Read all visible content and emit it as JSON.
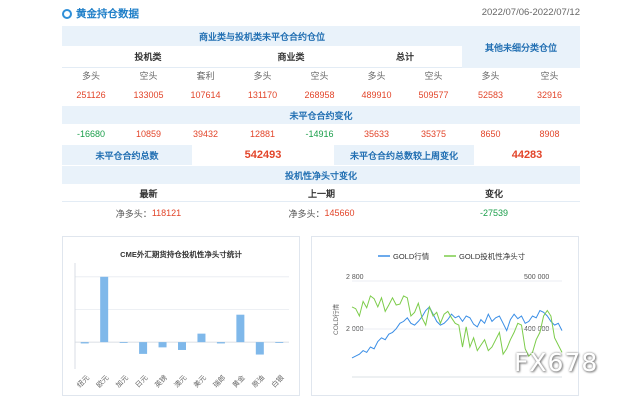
{
  "page": {
    "title": "黄金持仓数据",
    "date_range": "2022/07/06-2022/07/12"
  },
  "table": {
    "section1": {
      "title": "商业类与投机类未平仓合约仓位",
      "other_title": "其他未细分类仓位",
      "groups": {
        "spec": "投机类",
        "comm": "商业类",
        "total": "总计"
      },
      "labels": {
        "long": "多头",
        "short": "空头",
        "arb": "套利"
      },
      "values": [
        "251126",
        "133005",
        "107614",
        "131170",
        "268958",
        "489910",
        "509577",
        "52583",
        "32916"
      ]
    },
    "section2": {
      "title": "未平仓合约变化",
      "changes": [
        "-16680",
        "10859",
        "39432",
        "12881",
        "-14916",
        "35633",
        "35375",
        "8650",
        "8908"
      ],
      "oi_total_label": "未平仓合约总数",
      "oi_total": "542493",
      "oi_change_label": "未平仓合约总数较上周变化",
      "oi_change": "44283"
    },
    "section3": {
      "title": "投机性净头寸变化",
      "latest": "最新",
      "previous": "上一期",
      "change": "变化",
      "net_long_label": "净多头：",
      "latest_value": "118121",
      "previous_value": "145660",
      "change_value": "-27539"
    }
  },
  "left_chart": {
    "chart_data": {
      "type": "bar",
      "title": "CME外汇期货持仓投机性净头寸统计",
      "categories": [
        "纽元",
        "欧元",
        "加元",
        "日元",
        "英镑",
        "澳元",
        "美元",
        "瑞郎",
        "黄金",
        "原油",
        "白银"
      ],
      "values": [
        -2,
        100,
        0,
        -18,
        -8,
        -12,
        13,
        -2,
        42,
        -19,
        0
      ],
      "ylim": [
        -35,
        115
      ],
      "grid": true,
      "bar_color": "#7fb8ea"
    }
  },
  "right_chart": {
    "chart_data": {
      "type": "line",
      "legend": [
        "GOLD行情",
        "GOLD投机性净头寸"
      ],
      "legend_position": "top",
      "ylabel_left": "COLD行情",
      "left_ticks": [
        "2 800",
        "2 000"
      ],
      "right_ticks": [
        "500 000",
        "400 000"
      ],
      "series": [
        {
          "name": "GOLD行情",
          "color": "#3a8ee6",
          "values": [
            1500,
            1520,
            1540,
            1580,
            1560,
            1620,
            1600,
            1680,
            1720,
            1700,
            1760,
            1780,
            1820,
            1880,
            1900,
            1940,
            1880,
            1860,
            1900,
            1950,
            2020,
            2060,
            1980,
            1900,
            1860,
            1880,
            1920,
            1980,
            1940,
            1960,
            1900,
            1960,
            1940,
            1870,
            1840,
            1920,
            1880,
            1980,
            1900,
            1940,
            1960,
            1880,
            1800,
            1920,
            1980,
            1930,
            1960,
            1880,
            1900,
            1960,
            1940,
            2020,
            2000,
            1960,
            1900,
            1860,
            1880,
            1800
          ]
        },
        {
          "name": "GOLD投机性净头寸",
          "color": "#7ccc4a",
          "values": [
            2060,
            2040,
            1960,
            2120,
            2050,
            2180,
            2150,
            2060,
            2160,
            2010,
            2080,
            2160,
            2080,
            2090,
            2180,
            2160,
            1960,
            2000,
            2100,
            1940,
            1860,
            2060,
            1960,
            2000,
            1880,
            1980,
            2010,
            1940,
            1880,
            1860,
            1620,
            1840,
            1620,
            1720,
            1580,
            1640,
            1700,
            1580,
            1620,
            1700,
            1780,
            1540,
            1600,
            1700,
            1780,
            1880,
            1860,
            1600,
            1520,
            1560,
            1700,
            1780,
            1960,
            2020,
            1960,
            1720,
            1640,
            1560
          ]
        }
      ]
    }
  },
  "watermark": "FX678"
}
